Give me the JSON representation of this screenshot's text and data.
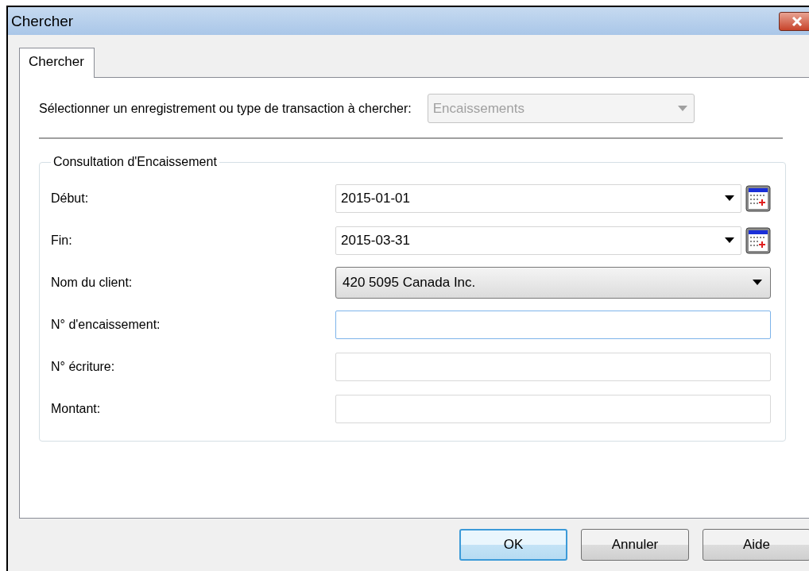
{
  "window": {
    "title": "Chercher"
  },
  "tabs": [
    {
      "label": "Chercher",
      "selected": true
    }
  ],
  "record_type": {
    "label": "Sélectionner un enregistrement ou type de transaction à chercher:",
    "value": "Encaissements",
    "disabled": true
  },
  "group": {
    "title": "Consultation d'Encaissement",
    "fields": [
      {
        "kind": "date",
        "label": "Début:",
        "value": "2015-01-01"
      },
      {
        "kind": "date",
        "label": "Fin:",
        "value": "2015-03-31"
      },
      {
        "kind": "dropdown",
        "label": "Nom du client:",
        "value": "420 5095 Canada Inc."
      },
      {
        "kind": "text",
        "label": "N° d'encaissement:",
        "focused": true
      },
      {
        "kind": "text",
        "label": "N° écriture:",
        "focused": false
      },
      {
        "kind": "text",
        "label": "Montant:",
        "focused": false
      }
    ]
  },
  "buttons": [
    {
      "label": "OK",
      "default": true
    },
    {
      "label": "Annuler",
      "default": false
    },
    {
      "label": "Aide",
      "default": false
    }
  ]
}
